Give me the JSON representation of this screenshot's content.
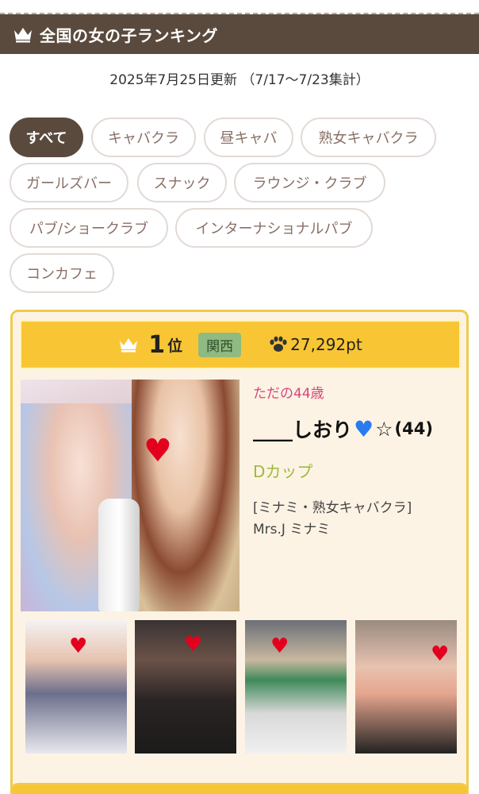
{
  "header": {
    "title": "全国の女の子ランキング"
  },
  "updated": "2025年7月25日更新 （7/17〜7/23集計）",
  "filters": [
    {
      "label": "すべて",
      "active": true
    },
    {
      "label": "キャバクラ"
    },
    {
      "label": "昼キャバ"
    },
    {
      "label": "熟女キャバクラ"
    },
    {
      "label": "ガールズバー"
    },
    {
      "label": "スナック"
    },
    {
      "label": "ラウンジ・クラブ"
    },
    {
      "label": "パブ/ショークラブ"
    },
    {
      "label": "インターナショナルパブ"
    },
    {
      "label": "コンカフェ"
    }
  ],
  "ranking": [
    {
      "rank": "1",
      "rank_unit": "位",
      "region": "関西",
      "points": "27,292pt",
      "catch": "ただの44歳",
      "name": "____しおり",
      "name_suffix": "☆",
      "age": "(44)",
      "cup": "Dカップ",
      "shop_line1": "[ミナミ・熟女キャバクラ]",
      "shop_line2": "Mrs.J ミナミ"
    }
  ],
  "icons": {
    "crown": "crown-icon",
    "paw": "paw-icon",
    "heart": "heart-sticker-icon"
  },
  "colors": {
    "header_bg": "#5a4a3d",
    "rank_bar": "#f8c634",
    "card_bg": "#fdf3e4",
    "catch": "#d8457a",
    "cup": "#9dbb3e",
    "region_badge": "#8fba82"
  }
}
